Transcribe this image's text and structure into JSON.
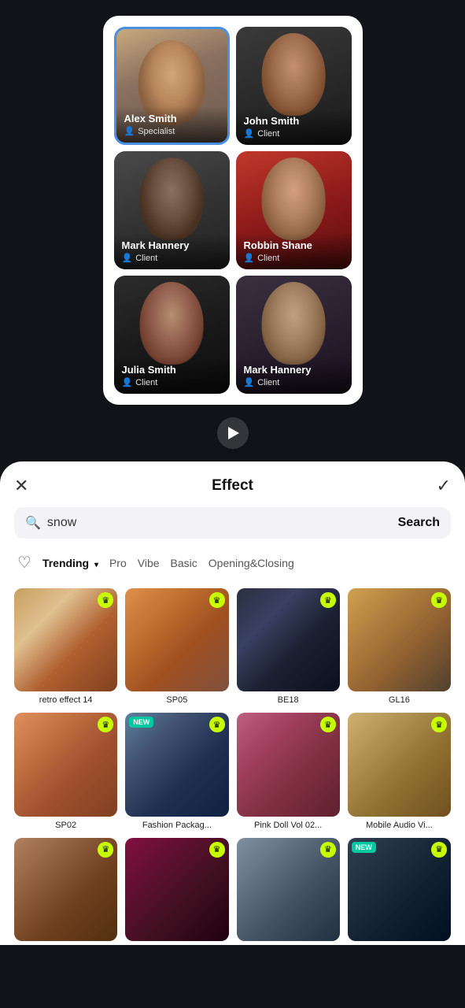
{
  "topArea": {
    "persons": [
      {
        "id": "alex",
        "name": "Alex Smith",
        "role": "Specialist",
        "selected": true,
        "colorClass": "person-alex",
        "faceClass": "alex-face"
      },
      {
        "id": "john",
        "name": "John Smith",
        "role": "Client",
        "selected": false,
        "colorClass": "person-john",
        "faceClass": "john-face"
      },
      {
        "id": "mark-hannery",
        "name": "Mark Hannery",
        "role": "Client",
        "selected": false,
        "colorClass": "person-mark-h",
        "faceClass": "mark-face"
      },
      {
        "id": "robbin",
        "name": "Robbin Shane",
        "role": "Client",
        "selected": false,
        "colorClass": "person-robbin",
        "faceClass": "robbin-face"
      },
      {
        "id": "julia",
        "name": "Julia Smith",
        "role": "Client",
        "selected": false,
        "colorClass": "person-julia",
        "faceClass": "julia-face"
      },
      {
        "id": "mark-h2",
        "name": "Mark Hannery",
        "role": "Client",
        "selected": false,
        "colorClass": "person-mark-h2",
        "faceClass": "mark2-face"
      }
    ]
  },
  "playButton": {
    "label": "Play"
  },
  "effectPanel": {
    "title": "Effect",
    "closeLabel": "✕",
    "confirmLabel": "✓",
    "search": {
      "placeholder": "snow",
      "value": "snow",
      "buttonLabel": "Search"
    },
    "filterTabs": [
      {
        "id": "heart",
        "label": "♡",
        "type": "heart"
      },
      {
        "id": "trending",
        "label": "Trending",
        "active": true,
        "hasChevron": true
      },
      {
        "id": "pro",
        "label": "Pro",
        "active": false
      },
      {
        "id": "vibe",
        "label": "Vibe",
        "active": false
      },
      {
        "id": "basic",
        "label": "Basic",
        "active": false
      },
      {
        "id": "opening",
        "label": "Opening&Closing",
        "active": false
      }
    ],
    "effects": [
      {
        "id": "retro14",
        "label": "retro effect 14",
        "thumbClass": "thumb-retro14",
        "hasCrown": true,
        "isNew": false
      },
      {
        "id": "sp05",
        "label": "SP05",
        "thumbClass": "thumb-sp05",
        "hasCrown": true,
        "isNew": false
      },
      {
        "id": "be18",
        "label": "BE18",
        "thumbClass": "thumb-be18",
        "hasCrown": true,
        "isNew": false
      },
      {
        "id": "gl16",
        "label": "GL16",
        "thumbClass": "thumb-gl16",
        "hasCrown": true,
        "isNew": false
      },
      {
        "id": "sp02",
        "label": "SP02",
        "thumbClass": "thumb-sp02",
        "hasCrown": true,
        "isNew": false
      },
      {
        "id": "fashion",
        "label": "Fashion Packag...",
        "thumbClass": "thumb-fashion",
        "hasCrown": true,
        "isNew": true
      },
      {
        "id": "pinkdoll",
        "label": "Pink Doll Vol 02...",
        "thumbClass": "thumb-pinkdoll",
        "hasCrown": true,
        "isNew": false
      },
      {
        "id": "mobile",
        "label": "Mobile Audio Vi...",
        "thumbClass": "thumb-mobile",
        "hasCrown": true,
        "isNew": false
      },
      {
        "id": "row3a",
        "label": "",
        "thumbClass": "thumb-row3a",
        "hasCrown": true,
        "isNew": false
      },
      {
        "id": "row3b",
        "label": "",
        "thumbClass": "thumb-row3b",
        "hasCrown": true,
        "isNew": false
      },
      {
        "id": "row3c",
        "label": "",
        "thumbClass": "thumb-row3c",
        "hasCrown": true,
        "isNew": false
      },
      {
        "id": "row3d",
        "label": "",
        "thumbClass": "thumb-row3d",
        "hasCrown": true,
        "isNew": true
      }
    ]
  },
  "icons": {
    "search": "🔍",
    "crown": "♛",
    "heart": "♡",
    "person": "👤",
    "play": "▶"
  },
  "colors": {
    "accent": "#4a90e2",
    "crown": "#c8ff00",
    "new": "#00c8a0",
    "dark": "#111318",
    "white": "#ffffff"
  }
}
